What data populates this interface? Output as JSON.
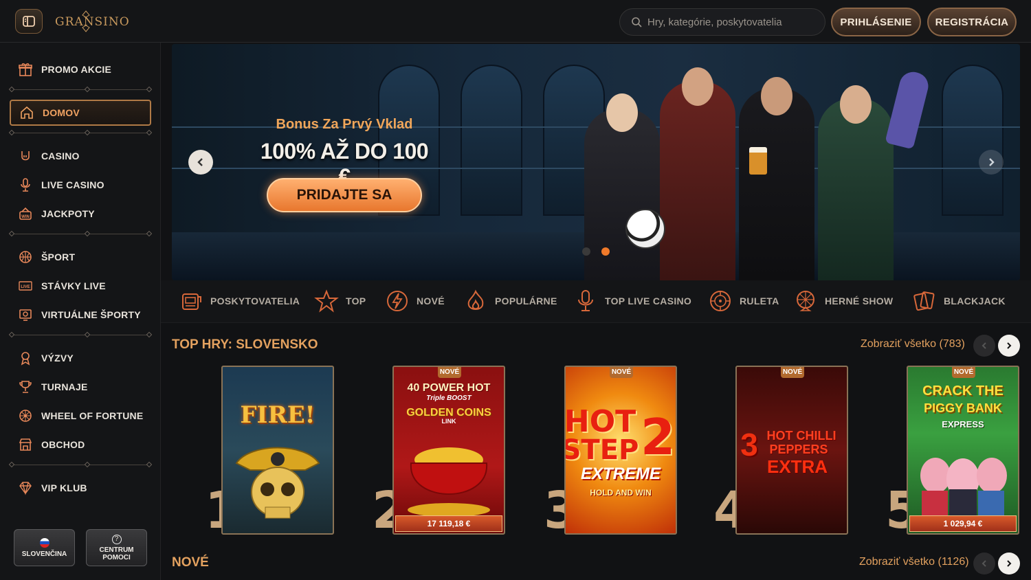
{
  "header": {
    "logo_text": "GRANSINO",
    "search_placeholder": "Hry, kategórie, poskytovatelia",
    "login_label": "PRIHLÁSENIE",
    "register_label": "REGISTRÁCIA"
  },
  "sidebar": {
    "items": [
      {
        "label": "PROMO AKCIE",
        "icon": "gift-icon"
      },
      {
        "label": "DOMOV",
        "icon": "home-icon",
        "active": true
      },
      {
        "label": "CASINO",
        "icon": "rock-hand-icon"
      },
      {
        "label": "LIVE CASINO",
        "icon": "microphone-icon"
      },
      {
        "label": "JACKPOTY",
        "icon": "jackpot-icon"
      },
      {
        "label": "ŠPORT",
        "icon": "basketball-icon"
      },
      {
        "label": "STÁVKY LIVE",
        "icon": "live-icon"
      },
      {
        "label": "VIRTUÁLNE ŠPORTY",
        "icon": "virtual-icon"
      },
      {
        "label": "VÝZVY",
        "icon": "medal-icon"
      },
      {
        "label": "TURNAJE",
        "icon": "trophy-icon"
      },
      {
        "label": "WHEEL OF FORTUNE",
        "icon": "wheel-icon"
      },
      {
        "label": "OBCHOD",
        "icon": "shop-icon"
      },
      {
        "label": "VIP KLUB",
        "icon": "diamond-icon"
      }
    ],
    "language_label": "SLOVENČINA",
    "help_label_1": "CENTRUM",
    "help_label_2": "POMOCI"
  },
  "banner": {
    "subtitle": "Bonus Za Prvý Vklad",
    "title": "100% AŽ DO 100 €",
    "cta_label": "PRIDAJTE SA",
    "active_slide": 2,
    "slide_count": 2
  },
  "categories": [
    {
      "label": "POSKYTOVATELIA",
      "icon": "slot-machine-icon"
    },
    {
      "label": "TOP",
      "icon": "star-icon"
    },
    {
      "label": "NOVÉ",
      "icon": "lightning-icon"
    },
    {
      "label": "POPULÁRNE",
      "icon": "flame-icon"
    },
    {
      "label": "TOP LIVE CASINO",
      "icon": "microphone-icon"
    },
    {
      "label": "RULETA",
      "icon": "roulette-icon"
    },
    {
      "label": "HERNÉ SHOW",
      "icon": "wheel-icon"
    },
    {
      "label": "BLACKJACK",
      "icon": "cards-icon"
    }
  ],
  "top_games": {
    "title": "TOP HRY: SLOVENSKO",
    "view_all": "Zobraziť všetko (783)",
    "games": [
      {
        "rank": "1",
        "title": "FIRE!",
        "badge": "",
        "jackpot": ""
      },
      {
        "rank": "2",
        "title": "40 POWER HOT",
        "subtitle": "Triple BOOST",
        "title2": "GOLDEN COINS",
        "title3": "LINK",
        "badge": "NOVÉ",
        "jackpot": "17 119,18 €"
      },
      {
        "rank": "3",
        "title": "HOT",
        "title2": "STEP",
        "title3": "2",
        "title4": "EXTREME",
        "title5": "HOLD AND WIN",
        "badge": "NOVÉ",
        "jackpot": ""
      },
      {
        "rank": "4",
        "title": "3",
        "title2": "HOT CHILLI",
        "title3": "PEPPERS",
        "title4": "EXTRA",
        "badge": "NOVÉ",
        "jackpot": ""
      },
      {
        "rank": "5",
        "title": "CRACK THE",
        "title2": "PIGGY BANK",
        "title3": "EXPRESS",
        "badge": "NOVÉ",
        "jackpot": "1 029,94 €"
      }
    ]
  },
  "new_games": {
    "title": "NOVÉ",
    "view_all": "Zobraziť všetko (1126)"
  },
  "colors": {
    "accent": "#e3a15f",
    "background": "#111214",
    "sidebar_active": "#f0a262",
    "cta": "#e8772e"
  }
}
